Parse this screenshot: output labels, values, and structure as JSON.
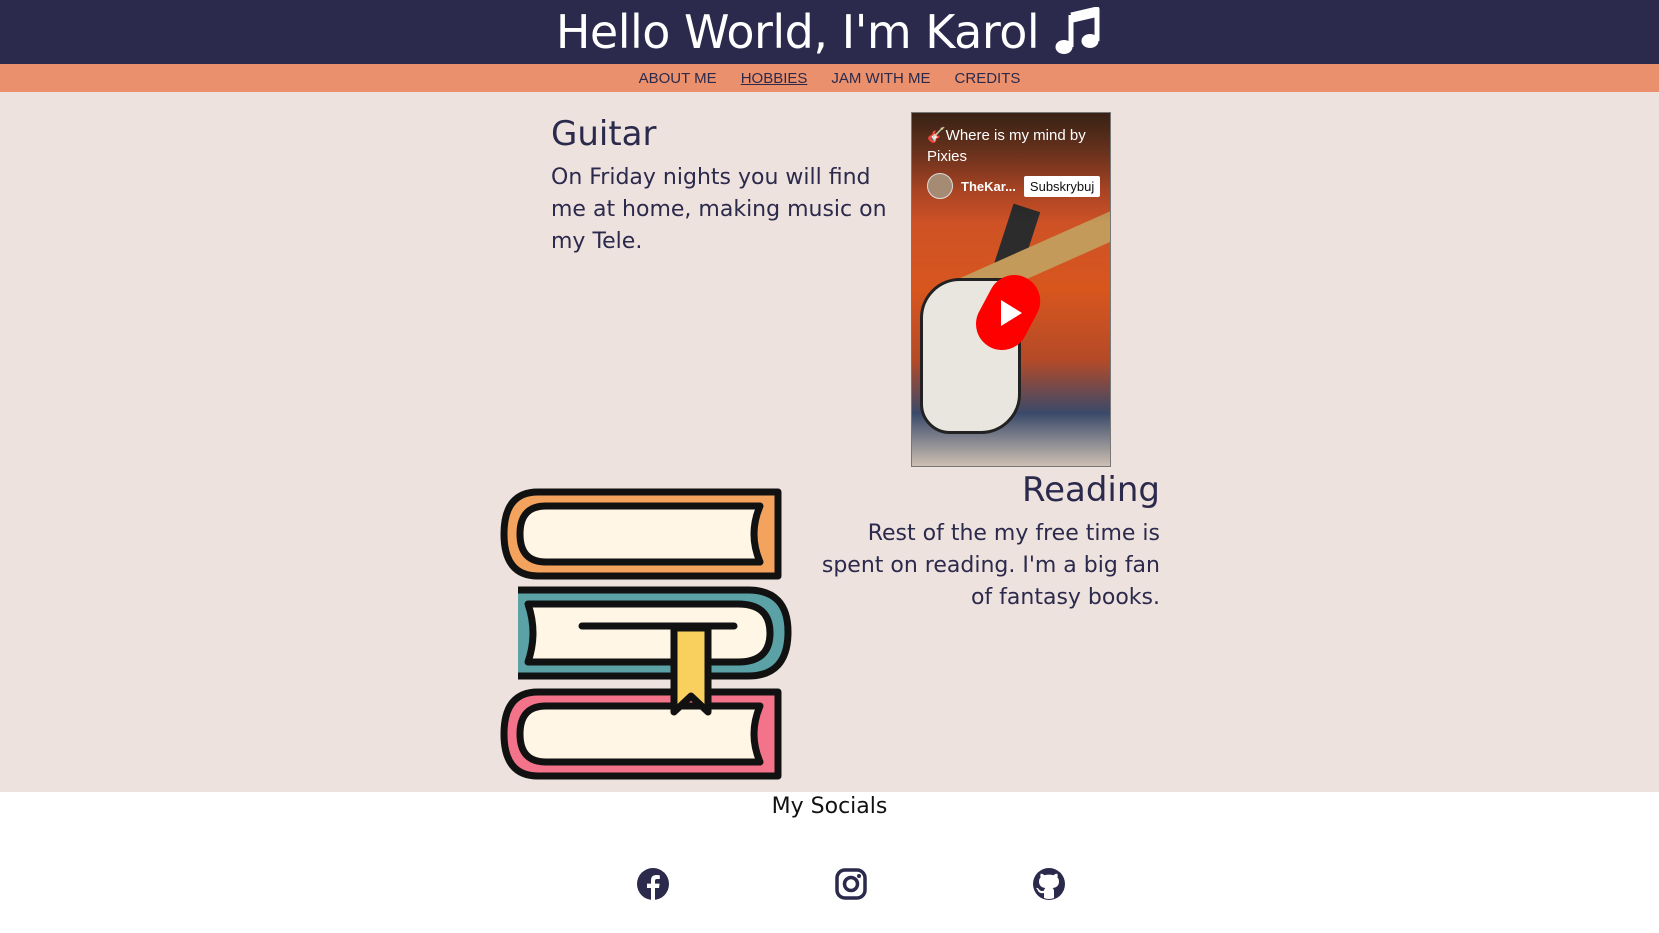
{
  "header": {
    "title": "Hello World, I'm Karol",
    "icon": "music-note-icon"
  },
  "nav": {
    "items": [
      {
        "label": "ABOUT ME",
        "active": false
      },
      {
        "label": "HOBBIES",
        "active": true
      },
      {
        "label": "JAM WITH ME",
        "active": false
      },
      {
        "label": "CREDITS",
        "active": false
      }
    ]
  },
  "guitar": {
    "title": "Guitar",
    "text": "On Friday nights you will find me at home, making music on my Tele.",
    "video": {
      "title": "🎸Where is my mind by Pixies",
      "channel": "TheKar...",
      "subscribe_label": "Subskrybuj",
      "play_icon": "youtube-shorts-play-icon"
    }
  },
  "reading": {
    "title": "Reading",
    "text": "Rest of the my free time is spent on reading. I'm a big fan of fantasy books.",
    "image": "books-stack-illustration"
  },
  "footer": {
    "title": "My Socials",
    "links": [
      {
        "icon": "facebook-icon"
      },
      {
        "icon": "instagram-icon"
      },
      {
        "icon": "github-icon"
      }
    ]
  },
  "colors": {
    "header_bg": "#2b2a4c",
    "nav_bg": "#ea906c",
    "content_bg": "#eee2de",
    "text": "#2b2a4c",
    "youtube_red": "#ff0000"
  }
}
